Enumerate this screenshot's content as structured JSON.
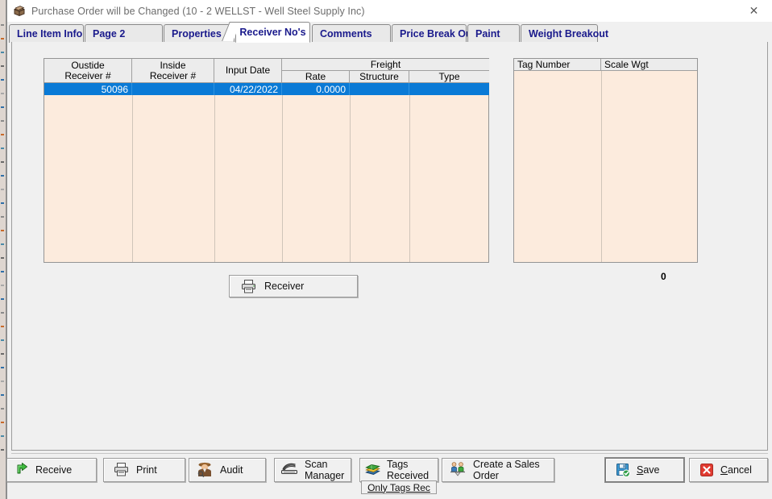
{
  "window": {
    "title": "Purchase Order will be Changed  (10 - 2  WELLST - Well Steel Supply Inc)",
    "icon": "package-box-icon",
    "close_label": "✕"
  },
  "tabs": [
    {
      "label": "Line Item Info",
      "active": false
    },
    {
      "label": "Page 2",
      "active": false
    },
    {
      "label": "Properties",
      "active": false
    },
    {
      "label": "Receiver No's",
      "active": true
    },
    {
      "label": "Comments",
      "active": false
    },
    {
      "label": "Price Break Out",
      "active": false
    },
    {
      "label": "Paint",
      "active": false
    },
    {
      "label": "Weight Breakout",
      "active": false
    }
  ],
  "receiver_grid": {
    "group_header": "Freight",
    "columns": [
      "Oustide\nReceiver #",
      "Inside\nReceiver #",
      "Input Date",
      "Rate",
      "Structure",
      "Type"
    ],
    "rows": [
      {
        "outside_receiver": "50096",
        "inside_receiver": "",
        "input_date": "04/22/2022",
        "rate": "0.0000",
        "structure": "",
        "type": "",
        "selected": true
      }
    ]
  },
  "tag_grid": {
    "columns": [
      "Tag Number",
      "Scale Wgt"
    ],
    "rows": [],
    "total": "0"
  },
  "receiver_print_button": {
    "label": "Receiver",
    "icon": "printer-icon"
  },
  "toolbar": [
    {
      "label": "Receive",
      "icon": "green-arrow-icon"
    },
    {
      "label": "Print",
      "icon": "printer-icon"
    },
    {
      "label": "Audit",
      "icon": "detective-icon"
    },
    {
      "label": "Scan\nManager",
      "icon": "scanner-icon"
    },
    {
      "label": "Tags Received",
      "icon": "books-icon",
      "sub_label": "Only Tags Rec"
    },
    {
      "label": "Create a Sales\nOrder",
      "icon": "sales-order-icon"
    }
  ],
  "actions": {
    "save": {
      "label": "Save",
      "accel": "S",
      "icon": "save-disk-icon"
    },
    "cancel": {
      "label": "Cancel",
      "accel": "C",
      "icon": "red-x-icon"
    }
  },
  "colors": {
    "tab_text": "#1a1a8c",
    "grid_bg": "#fcebdd",
    "selection": "#0a7ad6",
    "window_bg": "#f0f0f0",
    "header_bg": "#ececec"
  }
}
